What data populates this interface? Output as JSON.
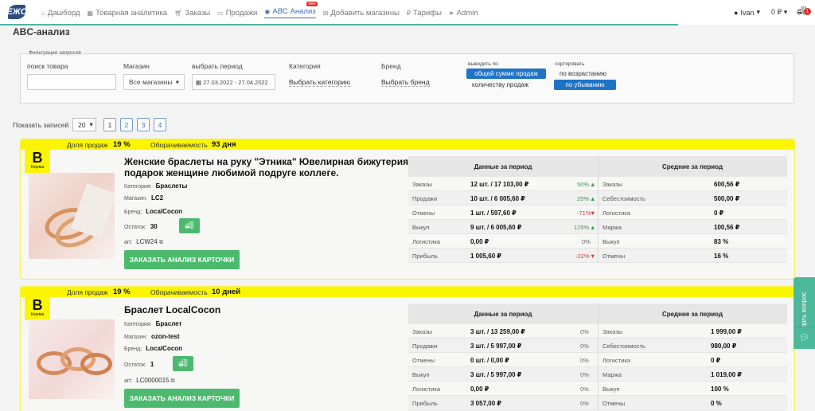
{
  "nav": {
    "logo_text": "ЕЖС",
    "items": [
      {
        "label": "Дашборд",
        "icon": "home-icon"
      },
      {
        "label": "Товарная аналитика",
        "icon": "grid-icon"
      },
      {
        "label": "Заказы",
        "icon": "cart-icon"
      },
      {
        "label": "Продажи",
        "icon": "card-icon"
      },
      {
        "label": "ABC Анализ",
        "icon": "eye-icon",
        "badge": "new"
      },
      {
        "label": "Добавить магазины",
        "icon": "add-store-icon"
      },
      {
        "label": "Тарифы",
        "icon": "ruble-icon"
      },
      {
        "label": "Admin",
        "icon": "send-icon"
      }
    ],
    "user": "Ivan",
    "balance": "0 ₽",
    "cart_count": "1"
  },
  "page_title": "ABC-анализ",
  "filter": {
    "legend": "Фильтрация запросов",
    "search_label": "поиск товара",
    "search_value": "",
    "store_label": "Магазин",
    "store_value": "Все магазины",
    "period_label": "выбрать период",
    "period_value": "27.03.2022 - 27.04.2022",
    "category_label": "Категория",
    "category_link": "Выбрать категорию",
    "brand_label": "Бренд",
    "brand_link": "Выбрать бренд",
    "output_label": "выводить по",
    "output_option_1": "общей сумме продаж",
    "output_option_2": "количеству продаж",
    "sort_label": "сортировать",
    "sort_option_1": "по возрастанию",
    "sort_option_2": "по убыванию"
  },
  "pagination": {
    "show_label": "Показать записей",
    "show_value": "20",
    "pages": [
      "1",
      "2",
      "3",
      "4"
    ]
  },
  "cards": [
    {
      "share_label": "Доля продаж",
      "share_value": "19 %",
      "turnover_label": "Оборачиваемость",
      "turnover_value": "93 дня",
      "grade": "B",
      "grade_sub": "Норма",
      "title": "Женские браслеты на руку \"Этника\" Ювелирная бижутерия подарок женщине любимой подруге коллеге.",
      "category_label": "Категория:",
      "category": "Браслеты",
      "store_label": "Магазин:",
      "store": "LC2",
      "brand_label": "Бренд:",
      "brand": "LocalCocon",
      "stock_label": "Остаток:",
      "stock": "30",
      "art_label": "art:",
      "art": "LCW24",
      "order_button": "ЗАКАЗАТЬ АНАЛИЗ КАРТОЧКИ",
      "period_header": "Данные за период",
      "avg_header": "Средние за период",
      "period_rows": [
        {
          "label": "Заказы",
          "value": "12 шт. / 17 103,00 ₽",
          "pct": "50%",
          "trend": "up"
        },
        {
          "label": "Продажи",
          "value": "10 шт. / 6 005,60 ₽",
          "pct": "25%",
          "trend": "up"
        },
        {
          "label": "Отмены",
          "value": "1 шт. / 597,60 ₽",
          "pct": "-71%",
          "trend": "down"
        },
        {
          "label": "Выкуп",
          "value": "9 шт. / 6 005,60 ₽",
          "pct": "125%",
          "trend": "up"
        },
        {
          "label": "Логистика",
          "value": "0,00 ₽",
          "pct": "0%",
          "trend": "none"
        },
        {
          "label": "Прибыль",
          "value": "1 005,60 ₽",
          "pct": "-22%",
          "trend": "down"
        }
      ],
      "avg_rows": [
        {
          "label": "Заказы",
          "value": "600,56 ₽"
        },
        {
          "label": "Себестоимость",
          "value": "500,00 ₽"
        },
        {
          "label": "Логистика",
          "value": "0 ₽"
        },
        {
          "label": "Маржа",
          "value": "100,56 ₽"
        },
        {
          "label": "Выкуп",
          "value": "83 %"
        },
        {
          "label": "Отмены",
          "value": "16 %"
        }
      ]
    },
    {
      "share_label": "Доля продаж",
      "share_value": "19 %",
      "turnover_label": "Оборачиваемость",
      "turnover_value": "10 дней",
      "grade": "B",
      "grade_sub": "Норма",
      "title": "Браслет LocalCocon",
      "category_label": "Категория:",
      "category": "Браслет",
      "store_label": "Магазин:",
      "store": "ozon-test",
      "brand_label": "Бренд:",
      "brand": "LocalCocon",
      "stock_label": "Остаток:",
      "stock": "1",
      "art_label": "art:",
      "art": "LC0000015",
      "order_button": "ЗАКАЗАТЬ АНАЛИЗ КАРТОЧКИ",
      "period_header": "Данные за период",
      "avg_header": "Средние за период",
      "period_rows": [
        {
          "label": "Заказы",
          "value": "3 шт. / 13 259,00 ₽",
          "pct": "0%",
          "trend": "none"
        },
        {
          "label": "Продажи",
          "value": "3 шт. / 5 997,00 ₽",
          "pct": "0%",
          "trend": "none"
        },
        {
          "label": "Отмены",
          "value": "0 шт. / 0,00 ₽",
          "pct": "0%",
          "trend": "none"
        },
        {
          "label": "Выкуп",
          "value": "3 шт. / 5 997,00 ₽",
          "pct": "0%",
          "trend": "none"
        },
        {
          "label": "Логистика",
          "value": "0,00 ₽",
          "pct": "0%",
          "trend": "none"
        },
        {
          "label": "Прибыль",
          "value": "3 057,00 ₽",
          "pct": "0%",
          "trend": "none"
        }
      ],
      "avg_rows": [
        {
          "label": "Заказы",
          "value": "1 999,00 ₽"
        },
        {
          "label": "Себестоимость",
          "value": "980,00 ₽"
        },
        {
          "label": "Логистика",
          "value": "0 ₽"
        },
        {
          "label": "Маржа",
          "value": "1 019,00 ₽"
        },
        {
          "label": "Выкуп",
          "value": "100 %"
        },
        {
          "label": "Отмены",
          "value": "0 %"
        }
      ]
    }
  ],
  "side_tab": "Задать вопрос"
}
